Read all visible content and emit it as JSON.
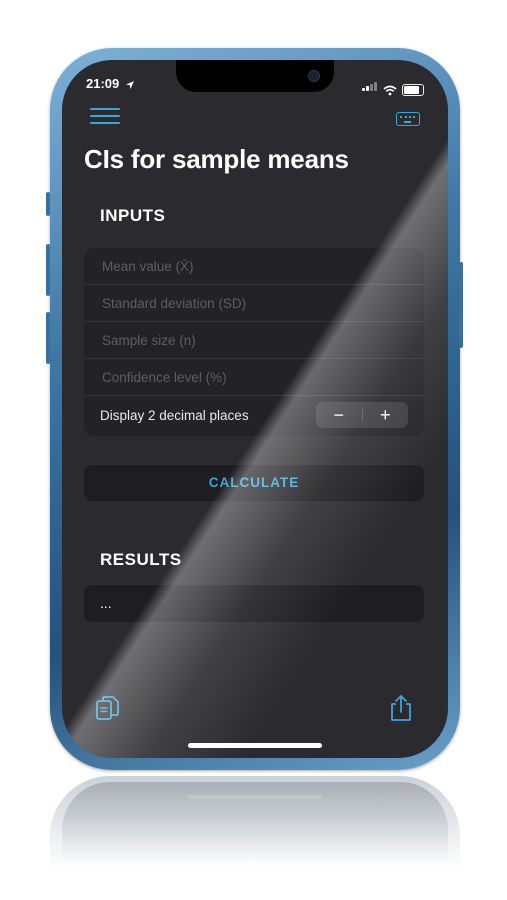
{
  "status": {
    "time": "21:09"
  },
  "header": {
    "title": "CIs for sample means"
  },
  "inputs": {
    "section_title": "INPUTS",
    "mean_placeholder": "Mean value (X̄)",
    "sd_placeholder": "Standard deviation (SD)",
    "n_placeholder": "Sample size (n)",
    "confidence_placeholder": "Confidence level (%)",
    "decimal_label": "Display 2 decimal places",
    "minus": "−",
    "plus": "+"
  },
  "actions": {
    "calculate_label": "CALCULATE"
  },
  "results": {
    "section_title": "RESULTS",
    "value": "..."
  },
  "colors": {
    "accent": "#3aa6d8",
    "background": "#2b2b2f",
    "card": "#232326"
  },
  "icons": [
    "menu-icon",
    "keyboard-icon",
    "copy-icon",
    "share-icon",
    "location-arrow-icon",
    "signal-icon",
    "wifi-icon",
    "battery-icon"
  ]
}
